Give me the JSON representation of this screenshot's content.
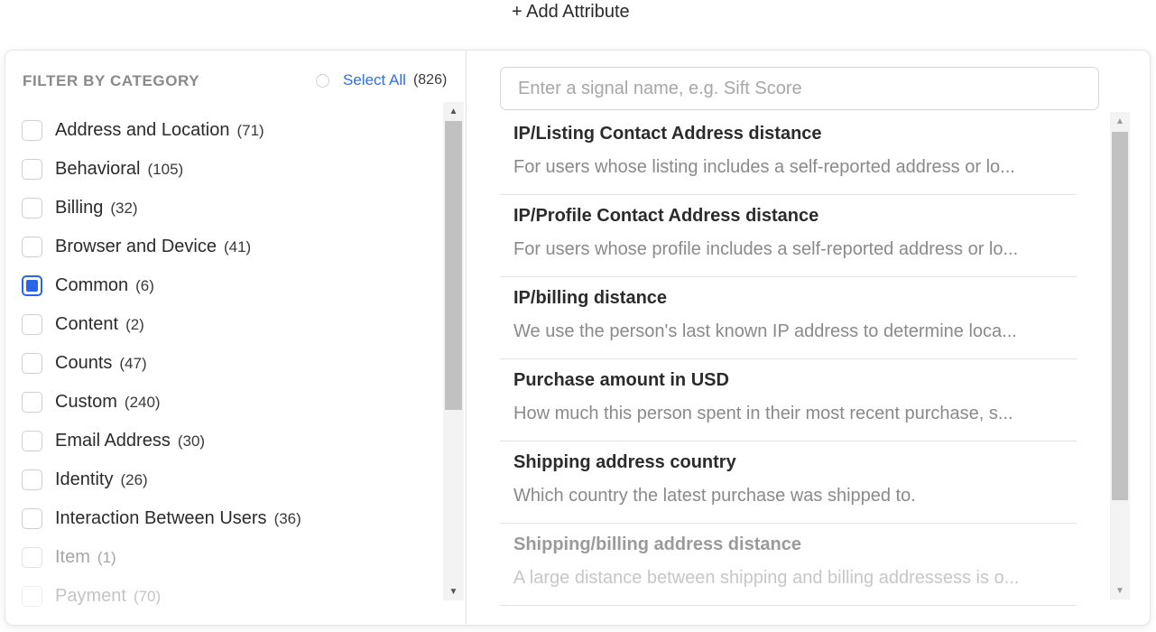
{
  "header": {
    "add_attribute_label": "+ Add Attribute"
  },
  "filter": {
    "title": "FILTER BY CATEGORY",
    "select_all_label": "Select All",
    "select_all_count": "(826)",
    "categories": [
      {
        "label": "Address and Location",
        "count": "(71)",
        "checked": false,
        "state": "normal"
      },
      {
        "label": "Behavioral",
        "count": "(105)",
        "checked": false,
        "state": "normal"
      },
      {
        "label": "Billing",
        "count": "(32)",
        "checked": false,
        "state": "normal"
      },
      {
        "label": "Browser and Device",
        "count": "(41)",
        "checked": false,
        "state": "normal"
      },
      {
        "label": "Common",
        "count": "(6)",
        "checked": true,
        "state": "normal"
      },
      {
        "label": "Content",
        "count": "(2)",
        "checked": false,
        "state": "normal"
      },
      {
        "label": "Counts",
        "count": "(47)",
        "checked": false,
        "state": "normal"
      },
      {
        "label": "Custom",
        "count": "(240)",
        "checked": false,
        "state": "normal"
      },
      {
        "label": "Email Address",
        "count": "(30)",
        "checked": false,
        "state": "normal"
      },
      {
        "label": "Identity",
        "count": "(26)",
        "checked": false,
        "state": "normal"
      },
      {
        "label": "Interaction Between Users",
        "count": "(36)",
        "checked": false,
        "state": "normal"
      },
      {
        "label": "Item",
        "count": "(1)",
        "checked": false,
        "state": "dim"
      },
      {
        "label": "Payment",
        "count": "(70)",
        "checked": false,
        "state": "faint"
      }
    ]
  },
  "search": {
    "placeholder": "Enter a signal name, e.g. Sift Score",
    "value": ""
  },
  "signals": [
    {
      "name": "IP/Listing Contact Address distance",
      "description": "For users whose listing includes a self-reported address or lo...",
      "state": "normal"
    },
    {
      "name": "IP/Profile Contact Address distance",
      "description": "For users whose profile includes a self-reported address or lo...",
      "state": "normal"
    },
    {
      "name": "IP/billing distance",
      "description": "We use the person's last known IP address to determine loca...",
      "state": "normal"
    },
    {
      "name": "Purchase amount in USD",
      "description": "How much this person spent in their most recent purchase, s...",
      "state": "normal"
    },
    {
      "name": "Shipping address country",
      "description": "Which country the latest purchase was shipped to.",
      "state": "normal"
    },
    {
      "name": "Shipping/billing address distance",
      "description": "A large distance between shipping and billing addressess is o...",
      "state": "dim"
    }
  ],
  "icons": {
    "scroll_up": "triangle-up-icon",
    "scroll_down": "triangle-down-icon",
    "up_glyph": "▲",
    "down_glyph": "▼"
  },
  "colors": {
    "accent": "#2a64e8",
    "link": "#2f6fe0"
  }
}
